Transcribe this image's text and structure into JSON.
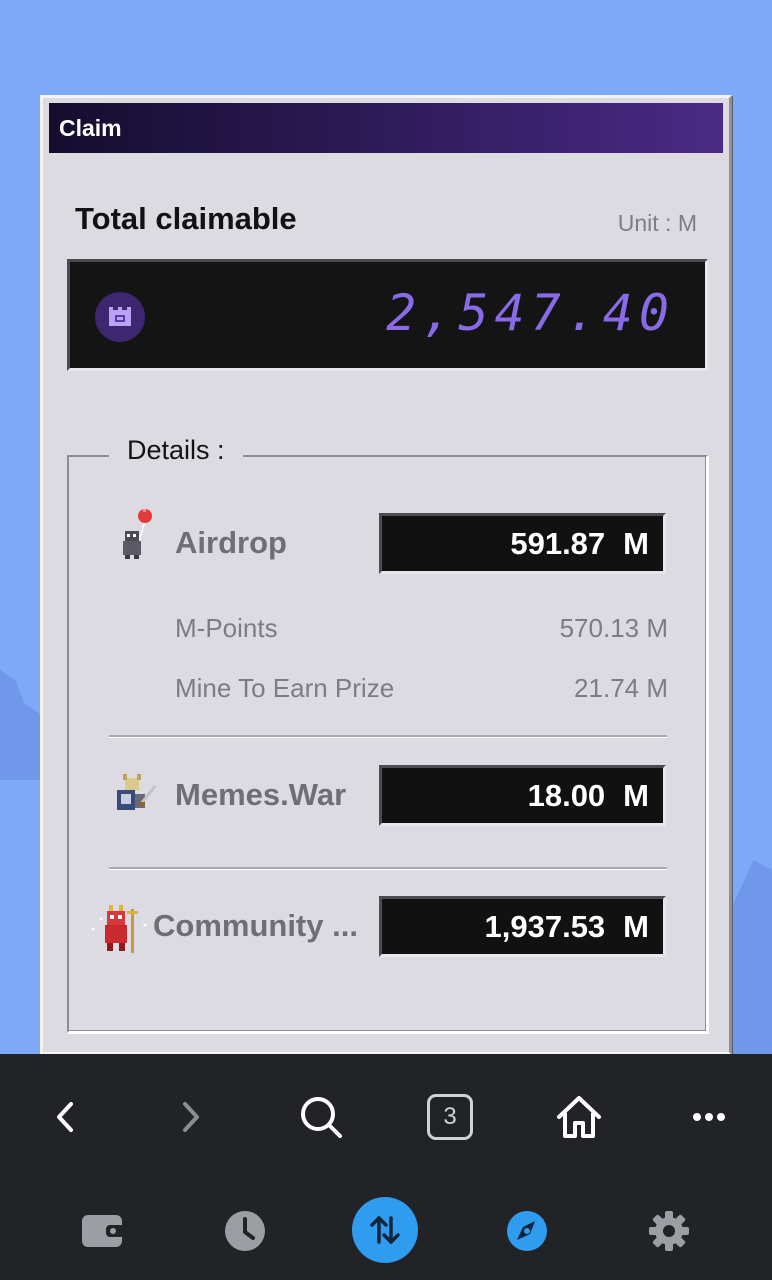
{
  "window": {
    "title": "Claim"
  },
  "total": {
    "label": "Total claimable",
    "unit": "Unit : M",
    "value": "2,547.40"
  },
  "details": {
    "legend": "Details :",
    "airdrop": {
      "label": "Airdrop",
      "value": "591.87",
      "unit": "M",
      "items": [
        {
          "label": "M-Points",
          "value": "570.13 M"
        },
        {
          "label": "Mine To Earn Prize",
          "value": "21.74 M"
        }
      ]
    },
    "memes_war": {
      "label": "Memes.War",
      "value": "18.00",
      "unit": "M"
    },
    "community": {
      "label": "Community ...",
      "value": "1,937.53",
      "unit": "M"
    }
  },
  "nav": {
    "tab_count": "3"
  },
  "colors": {
    "background": "#7ea8f8",
    "titlebar_start": "#150d2e",
    "titlebar_end": "#4a2a86",
    "digital_text": "#8a6ae6",
    "accent_blue": "#2f9cf0"
  },
  "icons": {
    "back": "chevron-left-icon",
    "forward": "chevron-right-icon",
    "search": "search-icon",
    "home": "home-icon",
    "more": "more-icon",
    "wallet": "wallet-icon",
    "history": "clock-icon",
    "swap": "swap-icon",
    "discover": "compass-icon",
    "settings": "gear-icon"
  }
}
